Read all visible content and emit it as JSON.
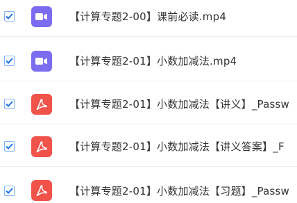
{
  "colors": {
    "check": "#1a73e8",
    "video_icon_bg": "#7b6cf0",
    "pdf_icon_bg": "#f0534a",
    "divider": "#e9edf2",
    "text": "#333333"
  },
  "files": [
    {
      "name": "【计算专题2-00】课前必读.mp4",
      "type": "video",
      "icon": "video-icon",
      "checked": true
    },
    {
      "name": "【计算专题2-01】小数加减法.mp4",
      "type": "video",
      "icon": "video-icon",
      "checked": true
    },
    {
      "name": "【计算专题2-01】小数加减法【讲义】_Passw",
      "type": "pdf",
      "icon": "pdf-icon",
      "checked": true
    },
    {
      "name": "【计算专题2-01】小数加减法【讲义答案】_F",
      "type": "pdf",
      "icon": "pdf-icon",
      "checked": true
    },
    {
      "name": "【计算专题2-01】小数加减法【习题】_Passw",
      "type": "pdf",
      "icon": "pdf-icon",
      "checked": true
    }
  ]
}
